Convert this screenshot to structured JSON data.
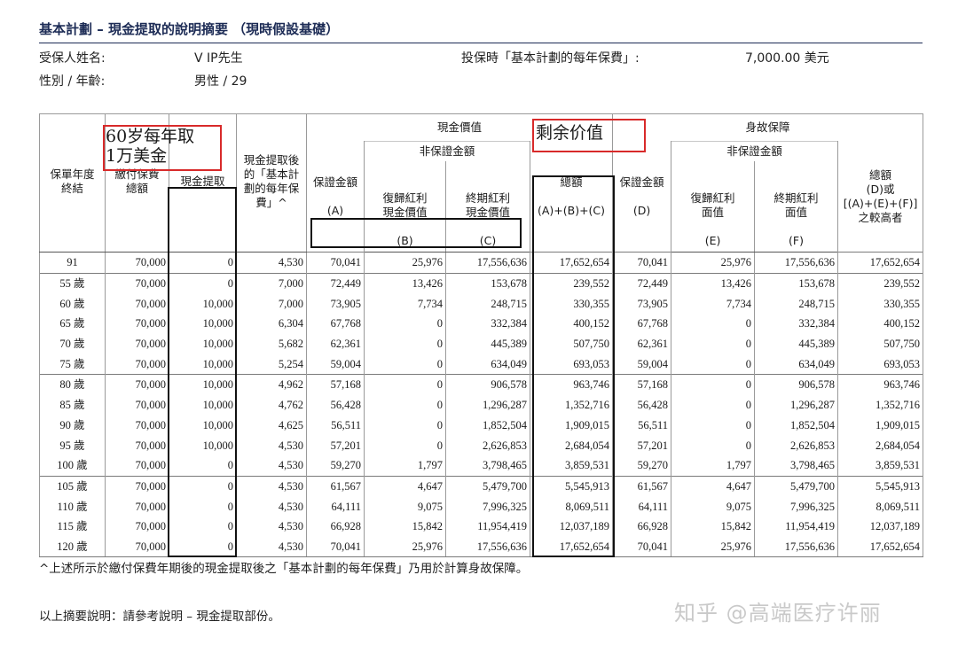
{
  "header": {
    "title": "基本計劃 – 現金提取的說明摘要 （現時假設基礎）",
    "insured_name_label": "受保人姓名:",
    "insured_name_value": "V IP先生",
    "gender_age_label": "性別 / 年齡:",
    "gender_age_value": "男性 / 29",
    "premium_label": "投保時「基本計劃的每年保費」:",
    "premium_value": "7,000.00 美元"
  },
  "annotations": {
    "withdraw_note_line1": "60岁每年取",
    "withdraw_note_line2": "1万美金",
    "remaining_value_note": "剩余价值"
  },
  "table": {
    "groups": {
      "cash_value": "現金價值",
      "non_guaranteed": "非保證金額",
      "death_benefit": "身故保障",
      "non_guaranteed_2": "非保證金額"
    },
    "columns": [
      {
        "lines": [
          "保單年度",
          "終結"
        ]
      },
      {
        "lines": [
          "繳付保費",
          "總額"
        ]
      },
      {
        "lines": [
          "現金提取"
        ]
      },
      {
        "lines": [
          "現金提取後",
          "的「基本計",
          "劃的每年保",
          "費」^"
        ]
      },
      {
        "lines": [
          "保證金額",
          "",
          "(A)"
        ]
      },
      {
        "lines": [
          "復歸紅利",
          "現金價值",
          "",
          "(B)"
        ]
      },
      {
        "lines": [
          "終期紅利",
          "現金價值",
          "",
          "(C)"
        ]
      },
      {
        "lines": [
          "總額",
          "",
          "(A)+(B)+(C)"
        ]
      },
      {
        "lines": [
          "保證金額",
          "",
          "(D)"
        ]
      },
      {
        "lines": [
          "復歸紅利",
          "面值",
          "",
          "(E)"
        ]
      },
      {
        "lines": [
          "終期紅利",
          "面值",
          "",
          "(F)"
        ]
      },
      {
        "lines": [
          "總額",
          "(D)或",
          "[(A)+(E)+(F)]",
          "之較高者"
        ]
      }
    ],
    "rows": [
      [
        "91",
        "70,000",
        "0",
        "4,530",
        "70,041",
        "25,976",
        "17,556,636",
        "17,652,654",
        "70,041",
        "25,976",
        "17,556,636",
        "17,652,654"
      ],
      [
        "55 歲",
        "70,000",
        "0",
        "7,000",
        "72,449",
        "13,426",
        "153,678",
        "239,552",
        "72,449",
        "13,426",
        "153,678",
        "239,552"
      ],
      [
        "60 歲",
        "70,000",
        "10,000",
        "7,000",
        "73,905",
        "7,734",
        "248,715",
        "330,355",
        "73,905",
        "7,734",
        "248,715",
        "330,355"
      ],
      [
        "65 歲",
        "70,000",
        "10,000",
        "6,304",
        "67,768",
        "0",
        "332,384",
        "400,152",
        "67,768",
        "0",
        "332,384",
        "400,152"
      ],
      [
        "70 歲",
        "70,000",
        "10,000",
        "5,682",
        "62,361",
        "0",
        "445,389",
        "507,750",
        "62,361",
        "0",
        "445,389",
        "507,750"
      ],
      [
        "75 歲",
        "70,000",
        "10,000",
        "5,254",
        "59,004",
        "0",
        "634,049",
        "693,053",
        "59,004",
        "0",
        "634,049",
        "693,053"
      ],
      [
        "80 歲",
        "70,000",
        "10,000",
        "4,962",
        "57,168",
        "0",
        "906,578",
        "963,746",
        "57,168",
        "0",
        "906,578",
        "963,746"
      ],
      [
        "85 歲",
        "70,000",
        "10,000",
        "4,762",
        "56,428",
        "0",
        "1,296,287",
        "1,352,716",
        "56,428",
        "0",
        "1,296,287",
        "1,352,716"
      ],
      [
        "90 歲",
        "70,000",
        "10,000",
        "4,625",
        "56,511",
        "0",
        "1,852,504",
        "1,909,015",
        "56,511",
        "0",
        "1,852,504",
        "1,909,015"
      ],
      [
        "95 歲",
        "70,000",
        "10,000",
        "4,530",
        "57,201",
        "0",
        "2,626,853",
        "2,684,054",
        "57,201",
        "0",
        "2,626,853",
        "2,684,054"
      ],
      [
        "100 歲",
        "70,000",
        "0",
        "4,530",
        "59,270",
        "1,797",
        "3,798,465",
        "3,859,531",
        "59,270",
        "1,797",
        "3,798,465",
        "3,859,531"
      ],
      [
        "105 歲",
        "70,000",
        "0",
        "4,530",
        "61,567",
        "4,647",
        "5,479,700",
        "5,545,913",
        "61,567",
        "4,647",
        "5,479,700",
        "5,545,913"
      ],
      [
        "110 歲",
        "70,000",
        "0",
        "4,530",
        "64,111",
        "9,075",
        "7,996,325",
        "8,069,511",
        "64,111",
        "9,075",
        "7,996,325",
        "8,069,511"
      ],
      [
        "115 歲",
        "70,000",
        "0",
        "4,530",
        "66,928",
        "15,842",
        "11,954,419",
        "12,037,189",
        "66,928",
        "15,842",
        "11,954,419",
        "12,037,189"
      ],
      [
        "120 歲",
        "70,000",
        "0",
        "4,530",
        "70,041",
        "25,976",
        "17,556,636",
        "17,652,654",
        "70,041",
        "25,976",
        "17,556,636",
        "17,652,654"
      ]
    ]
  },
  "footer": {
    "note": "^上述所示於繳付保費年期後的現金提取後之「基本計劃的每年保費」乃用於計算身故保障。",
    "summary": "以上摘要說明：請參考說明 – 現金提取部份。"
  },
  "watermark": "知乎 @高端医疗许丽"
}
